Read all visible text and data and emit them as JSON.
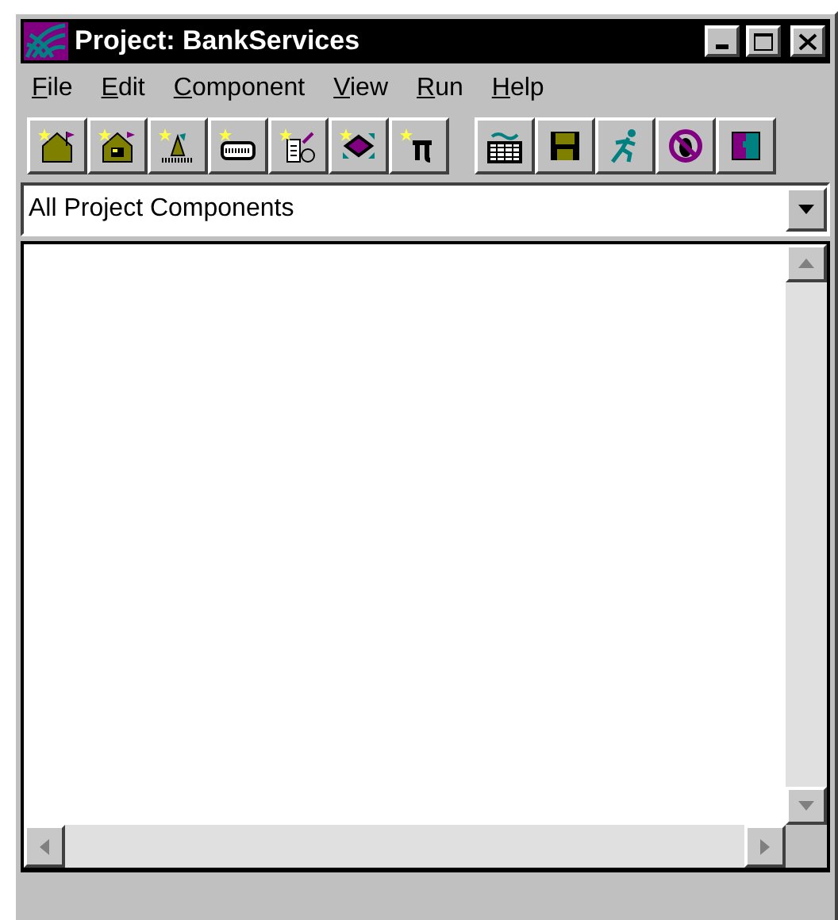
{
  "window": {
    "title": "Project: BankServices"
  },
  "menu": [
    {
      "accel": "F",
      "rest": "ile"
    },
    {
      "accel": "E",
      "rest": "dit"
    },
    {
      "accel": "C",
      "rest": "omponent"
    },
    {
      "accel": "V",
      "rest": "iew"
    },
    {
      "accel": "R",
      "rest": "un"
    },
    {
      "accel": "H",
      "rest": "elp"
    }
  ],
  "toolbar": [
    {
      "kind": "new-house"
    },
    {
      "kind": "new-house-window"
    },
    {
      "kind": "new-tower"
    },
    {
      "kind": "new-bar"
    },
    {
      "kind": "new-list"
    },
    {
      "kind": "new-cube"
    },
    {
      "kind": "new-pi"
    },
    {
      "kind": "gap"
    },
    {
      "kind": "factory"
    },
    {
      "kind": "save"
    },
    {
      "kind": "run"
    },
    {
      "kind": "no-bug"
    },
    {
      "kind": "puzzle"
    }
  ],
  "filter": {
    "value": "All Project Components"
  }
}
